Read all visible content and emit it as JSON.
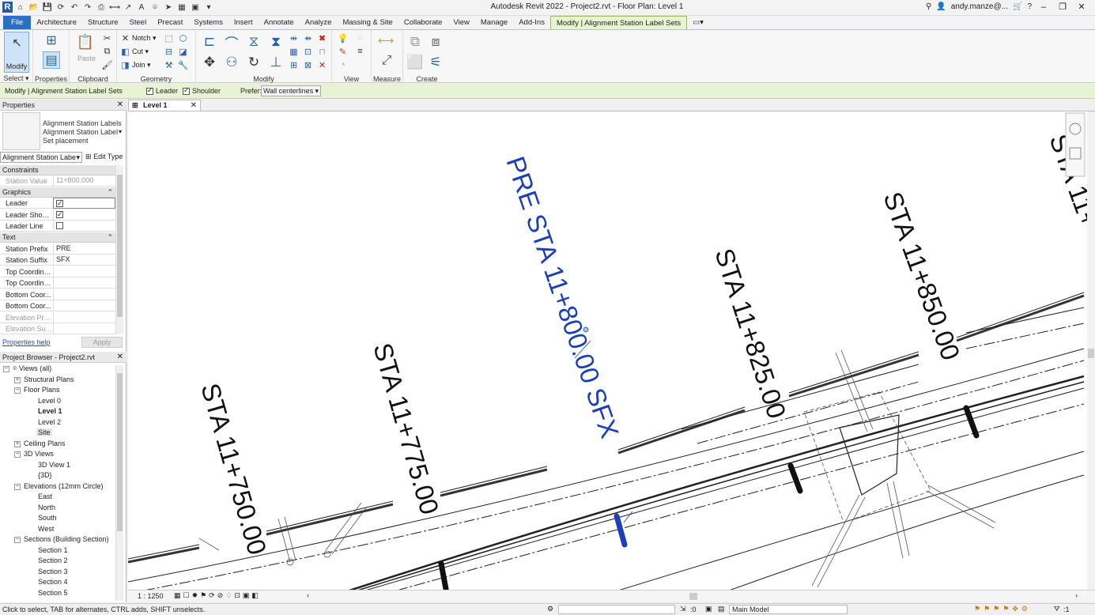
{
  "window": {
    "title": "Autodesk Revit 2022 - Project2.rvt - Floor Plan: Level 1",
    "user": "andy.manze@...",
    "minimize": "–",
    "restore": "❐",
    "close": "✕"
  },
  "tabs": [
    {
      "label": "File"
    },
    {
      "label": "Architecture"
    },
    {
      "label": "Structure"
    },
    {
      "label": "Steel"
    },
    {
      "label": "Precast"
    },
    {
      "label": "Systems"
    },
    {
      "label": "Insert"
    },
    {
      "label": "Annotate"
    },
    {
      "label": "Analyze"
    },
    {
      "label": "Massing & Site"
    },
    {
      "label": "Collaborate"
    },
    {
      "label": "View"
    },
    {
      "label": "Manage"
    },
    {
      "label": "Add-Ins"
    },
    {
      "label": "Modify | Alignment Station Label Sets"
    }
  ],
  "ribbon": {
    "modify_label": "Modify",
    "select_label": "Select",
    "properties_label": "Properties",
    "clipboard_label": "Clipboard",
    "paste_label": "Paste",
    "geometry_label": "Geometry",
    "notch_label": "Notch",
    "cut_label": "Cut",
    "join_label": "Join",
    "modify_panel_label": "Modify",
    "view_label": "View",
    "measure_label": "Measure",
    "create_label": "Create"
  },
  "options_bar": {
    "context": "Modify | Alignment Station Label Sets",
    "leader_label": "Leader",
    "leader_checked": true,
    "shoulder_label": "Shoulder",
    "shoulder_checked": true,
    "prefer_label": "Prefer:",
    "prefer_value": "Wall centerlines"
  },
  "properties": {
    "title": "Properties",
    "type_line1": "Alignment Station Labels",
    "type_line2": "Alignment Station Label",
    "type_line3": "Set placement",
    "selector": "Alignment Station Labe",
    "edit_type": "Edit Type",
    "groups": {
      "constraints": "Constraints",
      "graphics": "Graphics",
      "text": "Text"
    },
    "rows": {
      "station_value": {
        "name": "Station Value",
        "value": "11+800.000"
      },
      "leader": {
        "name": "Leader"
      },
      "leader_shoulder": {
        "name": "Leader Should..."
      },
      "leader_line": {
        "name": "Leader Line"
      },
      "station_prefix": {
        "name": "Station Prefix",
        "value": "PRE"
      },
      "station_suffix": {
        "name": "Station Suffix",
        "value": "SFX"
      },
      "top_coord_1": {
        "name": "Top Coordina..."
      },
      "top_coord_2": {
        "name": "Top Coordina..."
      },
      "bottom_coord_1": {
        "name": "Bottom Coor..."
      },
      "bottom_coord_2": {
        "name": "Bottom Coor..."
      },
      "elevation_prefix": {
        "name": "Elevation Prefix"
      },
      "elevation_suffix": {
        "name": "Elevation Suffix"
      }
    },
    "help": "Properties help",
    "apply": "Apply"
  },
  "browser": {
    "title": "Project Browser - Project2.rvt",
    "views_all": "Views (all)",
    "structural_plans": "Structural Plans",
    "floor_plans": "Floor Plans",
    "level0": "Level 0",
    "level1": "Level 1",
    "level2": "Level 2",
    "site": "Site",
    "ceiling_plans": "Ceiling Plans",
    "views_3d": "3D Views",
    "view3d1": "3D View 1",
    "view3d": "{3D}",
    "elevations": "Elevations (12mm Circle)",
    "east": "East",
    "north": "North",
    "south": "South",
    "west": "West",
    "sections": "Sections (Building Section)",
    "section1": "Section 1",
    "section2": "Section 2",
    "section3": "Section 3",
    "section4": "Section 4",
    "section5": "Section 5"
  },
  "view_tab": {
    "label": "Level 1"
  },
  "labels": {
    "sta750": "STA 11+750.00",
    "sta775": "STA 11+775.00",
    "sta800": "PRE STA 11+800.00 SFX",
    "sta825": "STA 11+825.00",
    "sta850": "STA 11+850.00",
    "sta875": "STA 11+"
  },
  "viewbar": {
    "scale": "1 : 1250"
  },
  "status": {
    "message": "Click to select, TAB for alternates, CTRL adds, SHIFT unselects.",
    "count": ":0",
    "model": "Main Model",
    "filter_count": ":1"
  },
  "colors": {
    "accent": "#2b6fc4",
    "selected_label": "#1a3fb8",
    "context_tab": "#e8f3d4"
  }
}
